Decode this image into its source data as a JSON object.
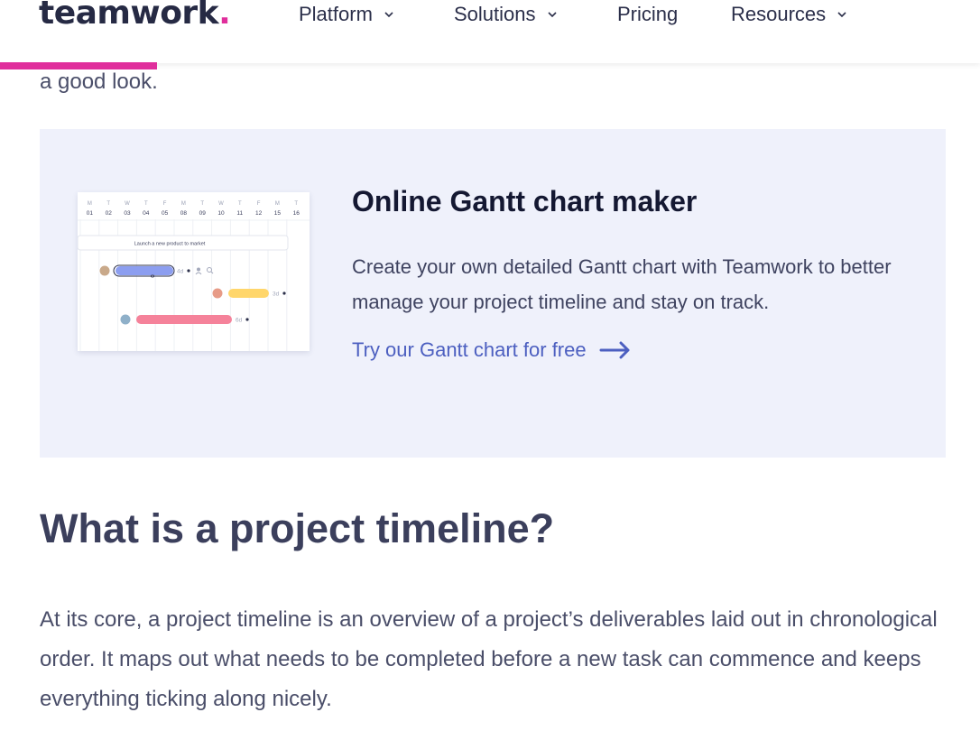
{
  "header": {
    "logo_text": "teamwork",
    "logo_dot": ".",
    "nav": [
      {
        "label": "Platform",
        "has_dropdown": true
      },
      {
        "label": "Solutions",
        "has_dropdown": true
      },
      {
        "label": "Pricing",
        "has_dropdown": false
      },
      {
        "label": "Resources",
        "has_dropdown": true
      }
    ],
    "brand_color": "#e02e9c"
  },
  "reading_progress": 0.16,
  "lead_text": "a good look.",
  "card": {
    "title": "Online Gantt chart maker",
    "text": "Create your own detailed Gantt chart with Teamwork to better manage your project timeline and stay on track.",
    "cta_label": "Try our Gantt chart for free",
    "cta_icon": "arrow-right-icon",
    "background": "#eff1fb",
    "gantt": {
      "days": [
        {
          "letter": "M",
          "num": "01"
        },
        {
          "letter": "T",
          "num": "02"
        },
        {
          "letter": "W",
          "num": "03"
        },
        {
          "letter": "T",
          "num": "04"
        },
        {
          "letter": "F",
          "num": "05"
        },
        {
          "letter": "M",
          "num": "08"
        },
        {
          "letter": "T",
          "num": "09"
        },
        {
          "letter": "W",
          "num": "10"
        },
        {
          "letter": "T",
          "num": "11"
        },
        {
          "letter": "F",
          "num": "12"
        },
        {
          "letter": "M",
          "num": "15"
        },
        {
          "letter": "T",
          "num": "16"
        }
      ],
      "task_title": "Launch a new product to market",
      "tasks": [
        {
          "duration": "4d",
          "color": "#8c9ef0"
        },
        {
          "duration": "3d",
          "color": "#ffd66b"
        },
        {
          "duration": "6d",
          "color": "#f5829a"
        }
      ]
    }
  },
  "section": {
    "heading": "What is a project timeline?",
    "paragraph": "At its core, a project timeline is an overview of a project’s deliverables laid out in chronological order. It maps out what needs to be completed before a new task can commence and keeps everything ticking along nicely."
  }
}
